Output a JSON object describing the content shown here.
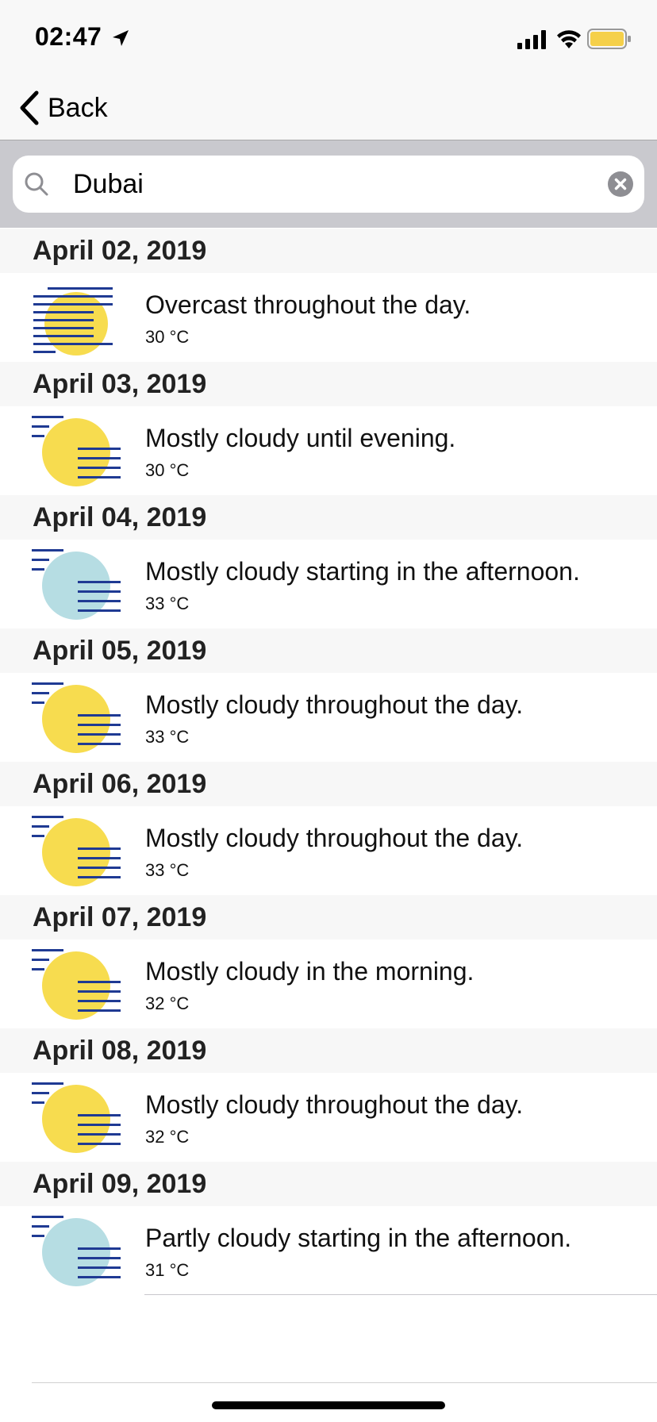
{
  "status_bar": {
    "time": "02:47",
    "icons": [
      "location-arrow-icon",
      "cellular-signal-icon",
      "wifi-icon",
      "battery-icon"
    ],
    "battery_color": "#f5d04a"
  },
  "nav": {
    "back_label": "Back",
    "back_icon": "chevron-left-icon"
  },
  "search": {
    "value": "Dubai",
    "icon": "magnifier-icon",
    "clear_icon": "clear-circle-icon"
  },
  "colors": {
    "sun": "#f7dc4f",
    "cloud_circle": "#b6dde3",
    "stripes": "#1f3a93",
    "section_bg": "#f7f7f7"
  },
  "forecast": [
    {
      "date": "April 02, 2019",
      "summary": "Overcast throughout the day.",
      "temp": "30 °C",
      "icon": "overcast-icon"
    },
    {
      "date": "April 03, 2019",
      "summary": "Mostly cloudy until evening.",
      "temp": "30 °C",
      "icon": "partly-sunny-icon"
    },
    {
      "date": "April 04, 2019",
      "summary": "Mostly cloudy starting in the afternoon.",
      "temp": "33 °C",
      "icon": "partly-cloudy-night-icon"
    },
    {
      "date": "April 05, 2019",
      "summary": "Mostly cloudy throughout the day.",
      "temp": "33 °C",
      "icon": "partly-sunny-icon"
    },
    {
      "date": "April 06, 2019",
      "summary": "Mostly cloudy throughout the day.",
      "temp": "33 °C",
      "icon": "partly-sunny-icon"
    },
    {
      "date": "April 07, 2019",
      "summary": "Mostly cloudy in the morning.",
      "temp": "32 °C",
      "icon": "partly-sunny-icon"
    },
    {
      "date": "April 08, 2019",
      "summary": "Mostly cloudy throughout the day.",
      "temp": "32 °C",
      "icon": "partly-sunny-icon"
    },
    {
      "date": "April 09, 2019",
      "summary": "Partly cloudy starting in the afternoon.",
      "temp": "31 °C",
      "icon": "partly-cloudy-night-icon"
    }
  ]
}
